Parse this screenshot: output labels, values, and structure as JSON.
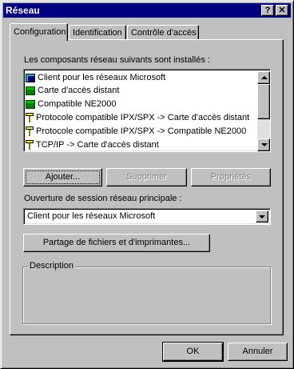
{
  "window": {
    "title": "Réseau",
    "help_label": "?",
    "close_label": "✕"
  },
  "tabs": [
    {
      "label": "Configuration",
      "active": true
    },
    {
      "label": "Identification",
      "active": false
    },
    {
      "label": "Contrôle d'accès",
      "active": false
    }
  ],
  "components": {
    "label": "Les composants réseau suivants sont installés :",
    "items": [
      {
        "label": "Client pour les réseaux Microsoft",
        "icon": "network-client-icon"
      },
      {
        "label": "Carte d'accès distant",
        "icon": "network-card-icon"
      },
      {
        "label": "Compatible NE2000",
        "icon": "network-card-icon"
      },
      {
        "label": "Protocole compatible IPX/SPX -> Carte d'accès distant",
        "icon": "protocol-icon"
      },
      {
        "label": "Protocole compatible IPX/SPX -> Compatible NE2000",
        "icon": "protocol-icon"
      },
      {
        "label": "TCP/IP -> Carte d'accès distant",
        "icon": "protocol-icon"
      }
    ]
  },
  "actions": {
    "add": "Ajouter...",
    "remove": "Supprimer",
    "properties": "Propriétés"
  },
  "logon": {
    "label": "Ouverture de session réseau principale :",
    "value": "Client pour les réseaux Microsoft"
  },
  "sharing_button": "Partage de fichiers et d'imprimantes...",
  "description": {
    "label": "Description",
    "text": ""
  },
  "footer": {
    "ok": "OK",
    "cancel": "Annuler"
  },
  "colors": {
    "titlebar": "#000080",
    "face": "#c0c0c0"
  }
}
